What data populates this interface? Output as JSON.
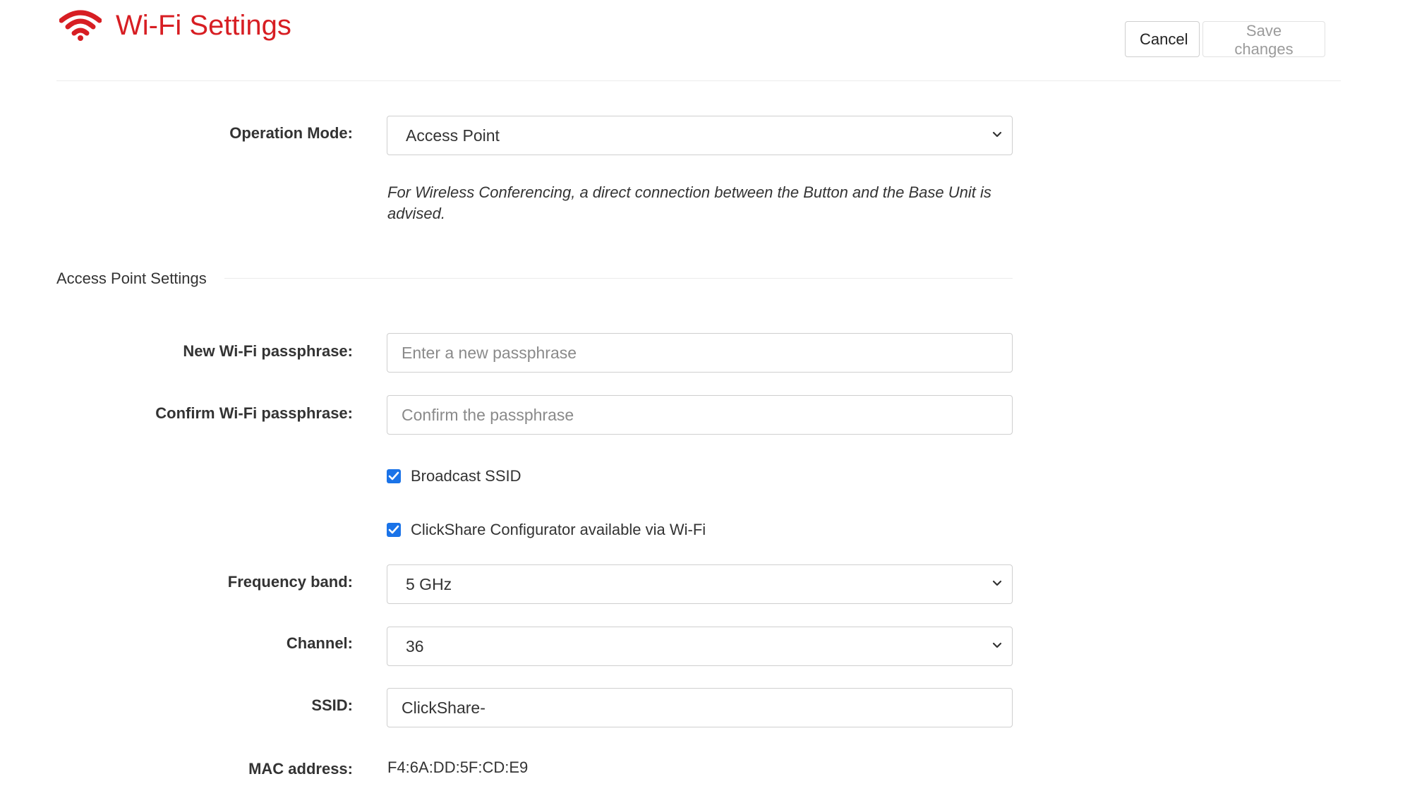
{
  "header": {
    "title": "Wi-Fi Settings",
    "cancel_label": "Cancel",
    "save_label": "Save changes"
  },
  "operation_mode": {
    "label": "Operation Mode:",
    "value": "Access Point",
    "help_text": "For Wireless Conferencing, a direct connection between the Button and the Base Unit is advised."
  },
  "access_point_settings": {
    "section_title": "Access Point Settings",
    "new_passphrase": {
      "label": "New Wi-Fi passphrase:",
      "placeholder": "Enter a new passphrase"
    },
    "confirm_passphrase": {
      "label": "Confirm Wi-Fi passphrase:",
      "placeholder": "Confirm the passphrase"
    },
    "broadcast_ssid": {
      "label": "Broadcast SSID",
      "checked": true
    },
    "configurator_wifi": {
      "label": "ClickShare Configurator available via Wi-Fi",
      "checked": true
    },
    "frequency_band": {
      "label": "Frequency band:",
      "value": "5 GHz"
    },
    "channel": {
      "label": "Channel:",
      "value": "36"
    },
    "ssid": {
      "label": "SSID:",
      "value": "ClickShare-"
    },
    "mac_address": {
      "label": "MAC address:",
      "value": "F4:6A:DD:5F:CD:E9"
    }
  },
  "colors": {
    "accent": "#d71e23",
    "checkbox": "#1a73e8",
    "border": "#cfcfcf"
  },
  "icons": {
    "logo": "wifi-icon",
    "dropdown": "chevron-down-icon",
    "checkbox": "checkmark-icon"
  }
}
